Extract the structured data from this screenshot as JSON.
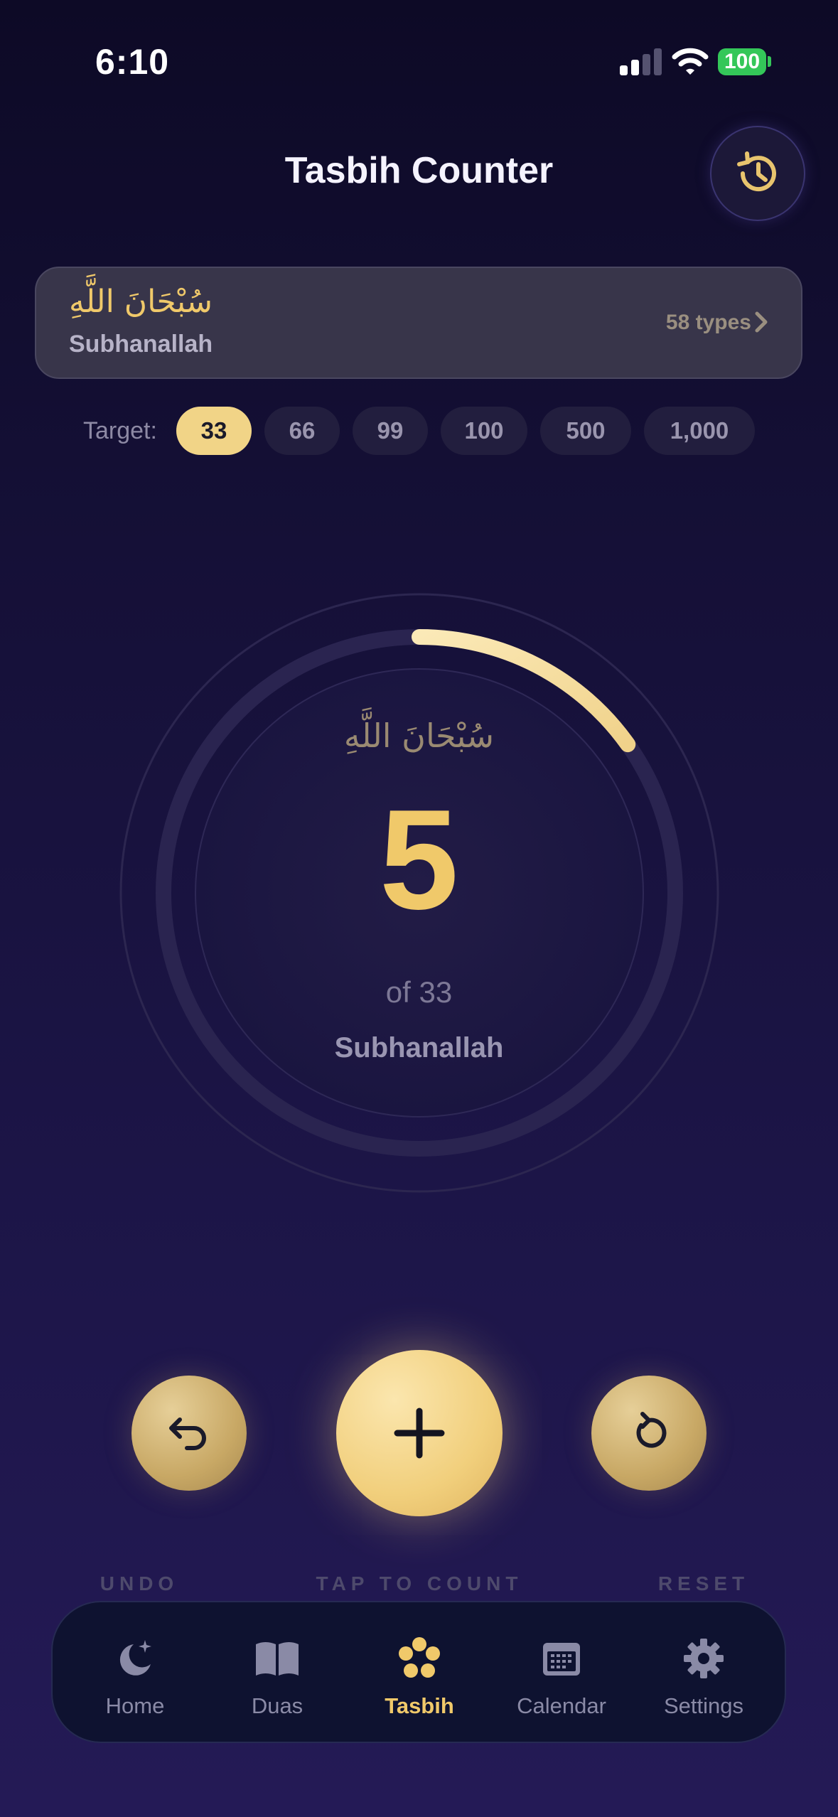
{
  "status_bar": {
    "time": "6:10",
    "battery": "100"
  },
  "header": {
    "title": "Tasbih Counter",
    "history_icon": "history-icon"
  },
  "dhikr": {
    "arabic": "سُبْحَانَ اللَّهِ",
    "latin": "Subhanallah",
    "types": "58 types"
  },
  "targets": {
    "label": "Target:",
    "options": [
      "33",
      "66",
      "99",
      "100",
      "500",
      "1,000"
    ],
    "selected": "33"
  },
  "counter": {
    "arabic": "سُبْحَانَ اللَّهِ",
    "count": "5",
    "of_target": "of 33",
    "latin": "Subhanallah",
    "progress": 0.1515
  },
  "controls": {
    "undo_label": "UNDO",
    "count_label": "TAP TO COUNT",
    "reset_label": "RESET"
  },
  "tabs": [
    {
      "label": "Home",
      "icon": "moon-stars-icon"
    },
    {
      "label": "Duas",
      "icon": "book-open-icon"
    },
    {
      "label": "Tasbih",
      "icon": "prayer-beads-icon",
      "active": true
    },
    {
      "label": "Calendar",
      "icon": "calendar-icon"
    },
    {
      "label": "Settings",
      "icon": "gear-icon"
    }
  ],
  "colors": {
    "accent": "#f0c96a",
    "active_pill": "#f1d487",
    "battery": "#34c759"
  }
}
